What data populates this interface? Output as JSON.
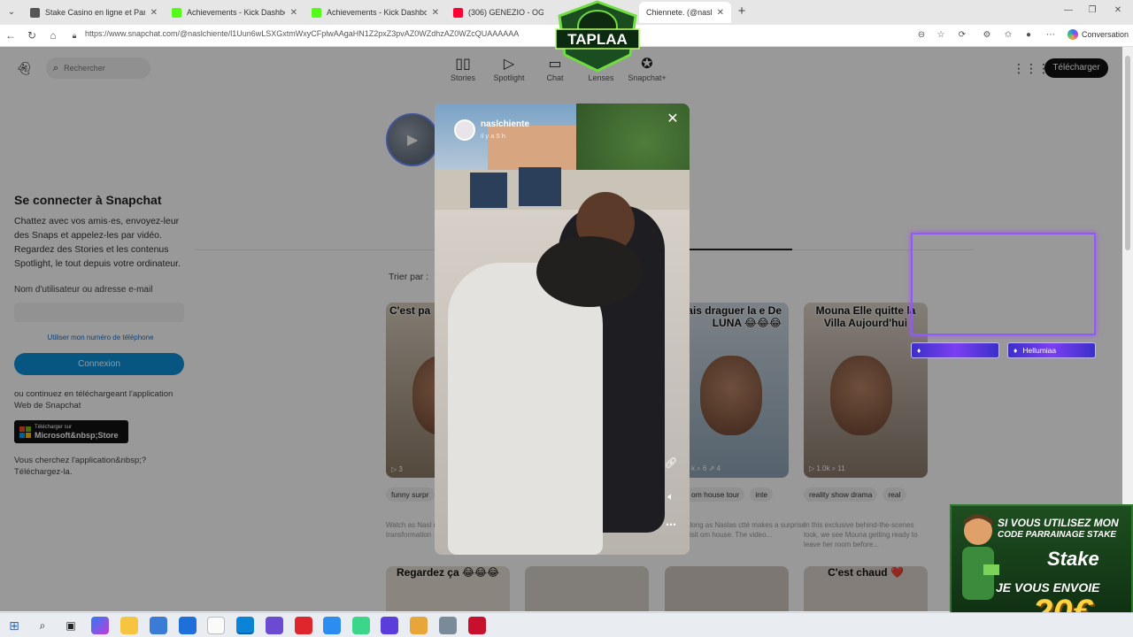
{
  "browser": {
    "tabs": [
      {
        "label": "Stake Casino en ligne et Paris Sporti",
        "fav": "#555555"
      },
      {
        "label": "Achievements - Kick Dashboard",
        "fav": "#53fc18"
      },
      {
        "label": "Achievements - Kick Dashboard",
        "fav": "#53fc18"
      },
      {
        "label": "(306) GENEZIO - OG (f",
        "fav": "#ff0033"
      },
      {
        "label": "Chiennete. (@nasl",
        "fav": "#fffc00"
      }
    ],
    "url": "https://www.snapchat.com/@naslchiente/l1Uun6wLSXGxtmWxyCFplwAAgaHN1Z2pxZ3pvAZ0WZdhzAZ0WZcQUAAAAAA",
    "conversation_label": "Conversation"
  },
  "snap": {
    "search_placeholder": "Rechercher",
    "nav": [
      {
        "label": "Stories",
        "icon": "stories-icon"
      },
      {
        "label": "Spotlight",
        "icon": "spotlight-icon"
      },
      {
        "label": "Chat",
        "icon": "chat-icon"
      },
      {
        "label": "Lenses",
        "icon": "lenses-icon"
      },
      {
        "label": "Snapchat+",
        "icon": "snapchat-plus-icon"
      }
    ],
    "download_label": "Télécharger",
    "login": {
      "title": "Se connecter à Snapchat",
      "description": "Chattez avec vos amis·es, envoyez-leur des Snaps et appelez-les par vidéo. Regardez des Stories et les contenus Spotlight, le tout depuis votre ordinateur.",
      "field_label": "Nom d'utilisateur ou adresse e-mail",
      "phone_link": "Utiliser mon numéro de téléphone",
      "connect_button": "Connexion",
      "or_text": "ou continuez en téléchargeant l'application Web de Snapchat",
      "ms_small": "Télécharger sur",
      "ms_big": "Microsoft&nbsp;Store",
      "more_text": "Vous cherchez l'application&nbsp;? Téléchargez-la."
    },
    "sort_label": "Trier par :",
    "cards": [
      {
        "caption": "C'est pa",
        "stats": "▷ 3",
        "tags": [
          "funny surpr"
        ],
        "desc": "Watch as Nasl unveils his incr transformation"
      },
      {
        "caption": "voulais draguer la e De LUNA 😂😂😂",
        "stats": "k ⌕ 6 ⇗ 4",
        "tags": [
          "om house tour",
          "inte"
        ],
        "desc": "along as Naslas ctté makes a surprise visit om house. The video..."
      },
      {
        "caption": "Mouna Elle quitte la Villa Aujourd'hui",
        "stats": "▷ 1.0k ⌕ 11",
        "tags": [
          "reality show drama",
          "real"
        ],
        "desc": "In this exclusive behind-the-scenes look, we see Mouna getting ready to leave her room before..."
      }
    ],
    "row2": [
      {
        "caption": "Regardez ça 😂😂😂"
      },
      {
        "caption": ""
      },
      {
        "caption": ""
      },
      {
        "caption": "C'est chaud ❤️"
      }
    ]
  },
  "video": {
    "username": "naslchiente",
    "time": "il y a 5 h"
  },
  "overlays": {
    "taplaa": "TAPLAA",
    "badge2": "Hellumiaa",
    "promo": {
      "line1": "SI VOUS UTILISEZ MON",
      "line2": "CODE PARRAINAGE STAKE",
      "brand": "Stake",
      "line3": "JE VOUS ENVOIE",
      "amount": "20€"
    }
  }
}
